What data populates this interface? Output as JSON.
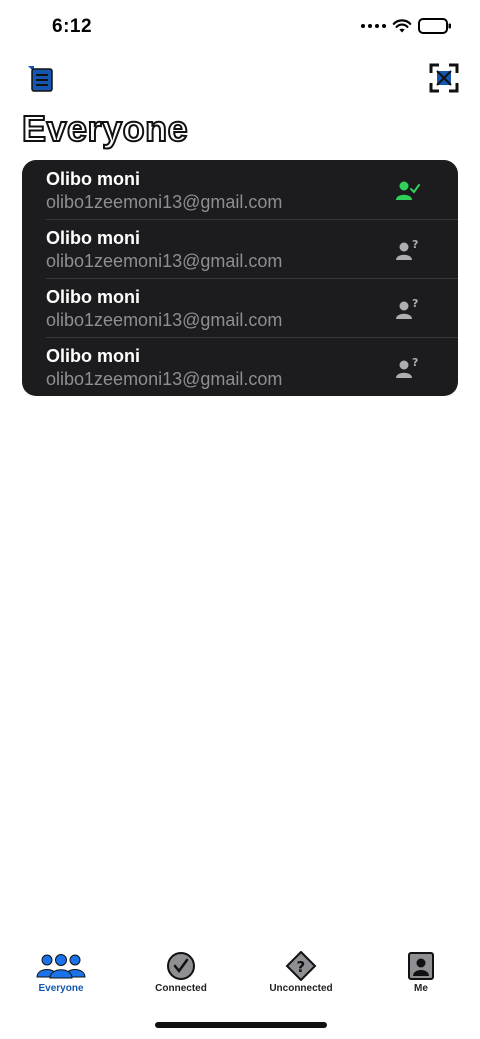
{
  "status_bar": {
    "time": "6:12"
  },
  "header": {
    "title": "Everyone",
    "left_icon": "document-icon",
    "right_icon": "qr-scan-icon",
    "accent": "#1557b0"
  },
  "contacts": [
    {
      "name": "Olibo moni",
      "email": "olibo1zeemoni13@gmail.com",
      "status": "connected"
    },
    {
      "name": "Olibo moni",
      "email": "olibo1zeemoni13@gmail.com",
      "status": "unconnected"
    },
    {
      "name": "Olibo moni",
      "email": "olibo1zeemoni13@gmail.com",
      "status": "unconnected"
    },
    {
      "name": "Olibo moni",
      "email": "olibo1zeemoni13@gmail.com",
      "status": "unconnected"
    }
  ],
  "colors": {
    "connected": "#30d158",
    "unconnected": "#aeaeb2",
    "list_background": "#1c1c1e"
  },
  "tabs": [
    {
      "label": "Everyone",
      "icon": "people-icon",
      "active": true
    },
    {
      "label": "Connected",
      "icon": "checkmark-circle-icon",
      "active": false
    },
    {
      "label": "Unconnected",
      "icon": "question-diamond-icon",
      "active": false
    },
    {
      "label": "Me",
      "icon": "contact-card-icon",
      "active": false
    }
  ]
}
